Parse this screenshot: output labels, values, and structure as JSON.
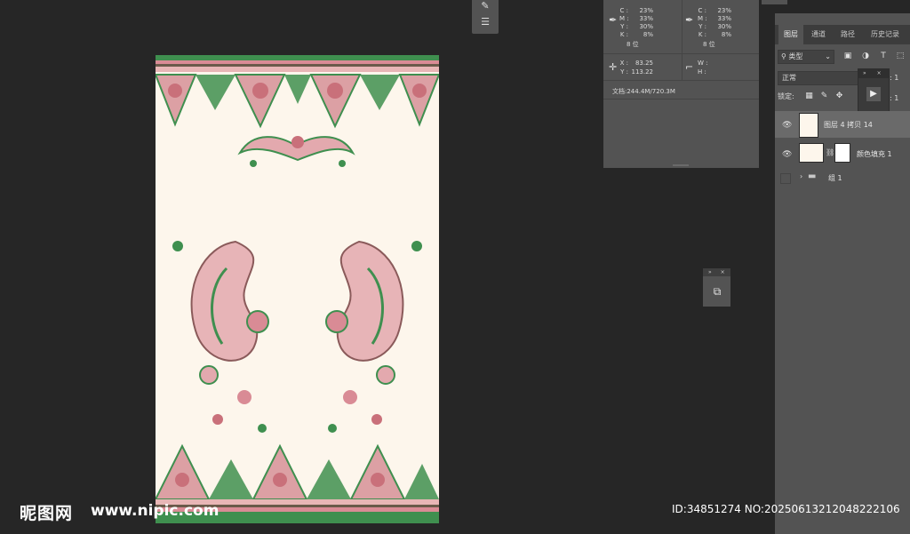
{
  "info_panel": {
    "cmyk_left": [
      {
        "label": "C :",
        "value": "23%"
      },
      {
        "label": "M :",
        "value": "33%"
      },
      {
        "label": "Y :",
        "value": "30%"
      },
      {
        "label": "K :",
        "value": "8%"
      }
    ],
    "cmyk_right": [
      {
        "label": "C :",
        "value": "23%"
      },
      {
        "label": "M :",
        "value": "33%"
      },
      {
        "label": "Y :",
        "value": "30%"
      },
      {
        "label": "K :",
        "value": "8%"
      }
    ],
    "bitdepth_left": "8 位",
    "bitdepth_right": "8 位",
    "x_label": "X :",
    "x_value": "83.25",
    "y_label": "Y :",
    "y_value": "113.22",
    "w_label": "W :",
    "h_label": "H :",
    "doc_size": "文档:244.4M/720.3M"
  },
  "layers_panel": {
    "tabs": [
      "图层",
      "通道",
      "路径",
      "历史记录"
    ],
    "filter_label": "类型",
    "blend_mode": "正常",
    "opacity_label": "明度: 1",
    "lock_label": "锁定:",
    "fill_label": "填充: 1",
    "layers": [
      {
        "name": "图层 4 拷贝 14",
        "visible": true
      },
      {
        "name": "颜色填充 1",
        "visible": true
      },
      {
        "name": "组 1",
        "visible": false
      }
    ]
  },
  "watermark": {
    "logo": "昵图网",
    "url": "www.nipic.com",
    "id_text": "ID:34851274 NO:20250613212048222106"
  },
  "icons": {
    "eyedropper": "eyedropper-icon",
    "crosshair": "crosshair-icon",
    "selection": "selection-size-icon",
    "eye": "eye-icon",
    "folder": "folder-icon",
    "play": "play-icon",
    "cube": "3d-cube-icon"
  },
  "colors": {
    "canvas_bg": "#fdf6ec",
    "workspace": "#262626",
    "panel": "#535353",
    "pattern_pink": "#d98b95",
    "pattern_green": "#3f8f4f"
  }
}
